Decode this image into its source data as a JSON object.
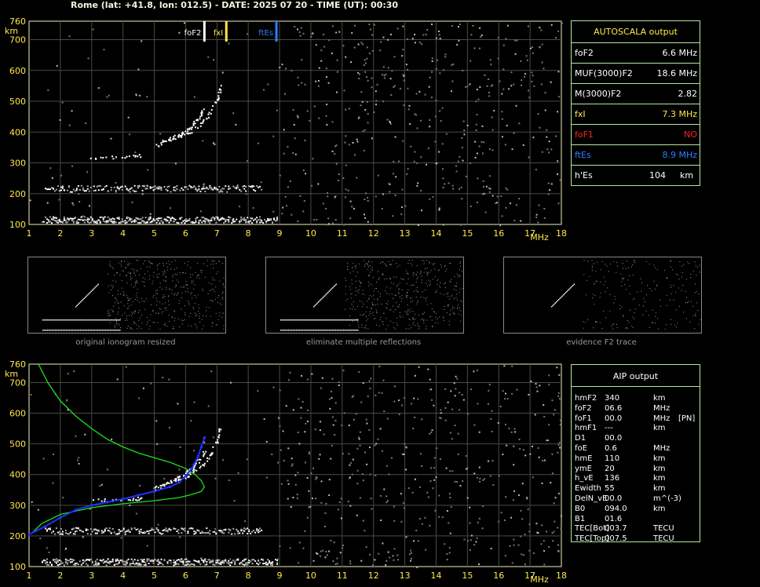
{
  "header": "Rome (lat: +41.8, lon: 012.5) - DATE: 2025 07 20 - TIME (UT): 00:30",
  "autoscala": {
    "title": "AUTOSCALA output",
    "rows": [
      {
        "label": "foF2",
        "value": "6.6 MHz",
        "color": "#ffffff"
      },
      {
        "label": "MUF(3000)F2",
        "value": "18.6 MHz",
        "color": "#ffffff"
      },
      {
        "label": "M(3000)F2",
        "value": "2.82",
        "color": "#ffffff"
      },
      {
        "label": "fxI",
        "value": "7.3 MHz",
        "color": "#ffe94d"
      },
      {
        "label": "foF1",
        "value": "NO",
        "color": "#ff2020"
      },
      {
        "label": "ftEs",
        "value": "8.9 MHz",
        "color": "#2e7dff"
      },
      {
        "label": "h'Es",
        "value": "104",
        "unit": "km",
        "color": "#ffffff"
      }
    ]
  },
  "aip": {
    "title": "AIP output",
    "rows": [
      [
        "hmF2",
        "340",
        "km",
        ""
      ],
      [
        "foF2",
        "06.6",
        "MHz",
        ""
      ],
      [
        "foF1",
        "00.0",
        "MHz",
        "[PN]"
      ],
      [
        "hmF1",
        "---",
        "km",
        ""
      ],
      [
        "D1",
        "00.0",
        "",
        ""
      ],
      [
        "foE",
        "0.6",
        "MHz",
        ""
      ],
      [
        "hmE",
        "110",
        "km",
        ""
      ],
      [
        "ymE",
        "20",
        "km",
        ""
      ],
      [
        "h_vE",
        "136",
        "km",
        ""
      ],
      [
        "Ewidth",
        "55",
        "km",
        ""
      ],
      [
        "DelN_vE",
        "00.0",
        "m^(-3)",
        ""
      ],
      [
        "B0",
        "094.0",
        "km",
        ""
      ],
      [
        "B1",
        "01.6",
        "",
        ""
      ],
      [
        "TEC[Bot]",
        "003.7",
        "TECU",
        ""
      ],
      [
        "TEC[Top]",
        "007.5",
        "TECU",
        ""
      ]
    ]
  },
  "thumbnails": [
    {
      "caption": "original ionogram resized"
    },
    {
      "caption": "eliminate multiple reflections"
    },
    {
      "caption": "evidence F2 trace"
    }
  ],
  "chart_data": [
    {
      "type": "scatter",
      "name": "top-ionogram",
      "xlabel": "MHz",
      "ylabel": "km",
      "xlim": [
        1,
        18
      ],
      "ylim": [
        100,
        760
      ],
      "xticks": [
        1,
        2,
        3,
        4,
        5,
        6,
        7,
        8,
        9,
        10,
        11,
        12,
        13,
        14,
        15,
        16,
        17,
        18
      ],
      "yticks": [
        100,
        200,
        300,
        400,
        500,
        600,
        700,
        760
      ],
      "grid": true,
      "markers": [
        {
          "label": "foF2",
          "x": 6.6,
          "color": "#ffffff"
        },
        {
          "label": "fxI",
          "x": 7.3,
          "color": "#ffe94d"
        },
        {
          "label": "ftEs",
          "x": 8.9,
          "color": "#2e7dff"
        }
      ],
      "traces": [
        {
          "name": "Es",
          "x": [
            1.4,
            8.9
          ],
          "y": 117
        },
        {
          "name": "Es2",
          "x": [
            1.5,
            8.4
          ],
          "y": 218
        },
        {
          "name": "F2o",
          "x": [
            3.0,
            4.2,
            5.0,
            5.5,
            5.9,
            6.2,
            6.4,
            6.6
          ],
          "y": [
            318,
            322,
            355,
            380,
            398,
            420,
            450,
            480
          ]
        },
        {
          "name": "F2x",
          "x": [
            5.2,
            5.7,
            6.1,
            6.5,
            6.8,
            7.0,
            7.1
          ],
          "y": [
            370,
            385,
            400,
            430,
            470,
            510,
            550
          ]
        }
      ]
    },
    {
      "type": "line",
      "name": "bottom-ionogram",
      "xlabel": "MHz",
      "ylabel": "km",
      "xlim": [
        1,
        18
      ],
      "ylim": [
        100,
        760
      ],
      "xticks": [
        1,
        2,
        3,
        4,
        5,
        6,
        7,
        8,
        9,
        10,
        11,
        12,
        13,
        14,
        15,
        16,
        17,
        18
      ],
      "yticks": [
        100,
        200,
        300,
        400,
        500,
        600,
        700,
        760
      ],
      "grid": true,
      "series": [
        {
          "name": "profile",
          "color": "#20e020",
          "x": [
            1.3,
            1.6,
            2.0,
            2.5,
            3.0,
            3.5,
            4.0,
            4.5,
            5.0,
            5.5,
            6.0,
            6.3,
            6.5,
            6.6,
            6.5,
            6.2,
            5.8,
            5.0,
            4.0,
            3.0,
            2.0,
            1.4,
            1.1
          ],
          "y": [
            760,
            700,
            640,
            590,
            550,
            515,
            490,
            470,
            455,
            440,
            420,
            400,
            380,
            360,
            345,
            335,
            325,
            315,
            305,
            292,
            270,
            240,
            210
          ]
        },
        {
          "name": "virtual-height",
          "color": "#2030ff",
          "x": [
            1.0,
            1.5,
            2.0,
            2.5,
            3.0,
            3.5,
            4.0,
            4.5,
            5.0,
            5.5,
            5.8,
            6.0,
            6.2,
            6.4,
            6.5,
            6.6
          ],
          "y": [
            205,
            230,
            260,
            285,
            300,
            310,
            320,
            333,
            345,
            360,
            375,
            395,
            420,
            460,
            490,
            520
          ]
        }
      ]
    }
  ]
}
